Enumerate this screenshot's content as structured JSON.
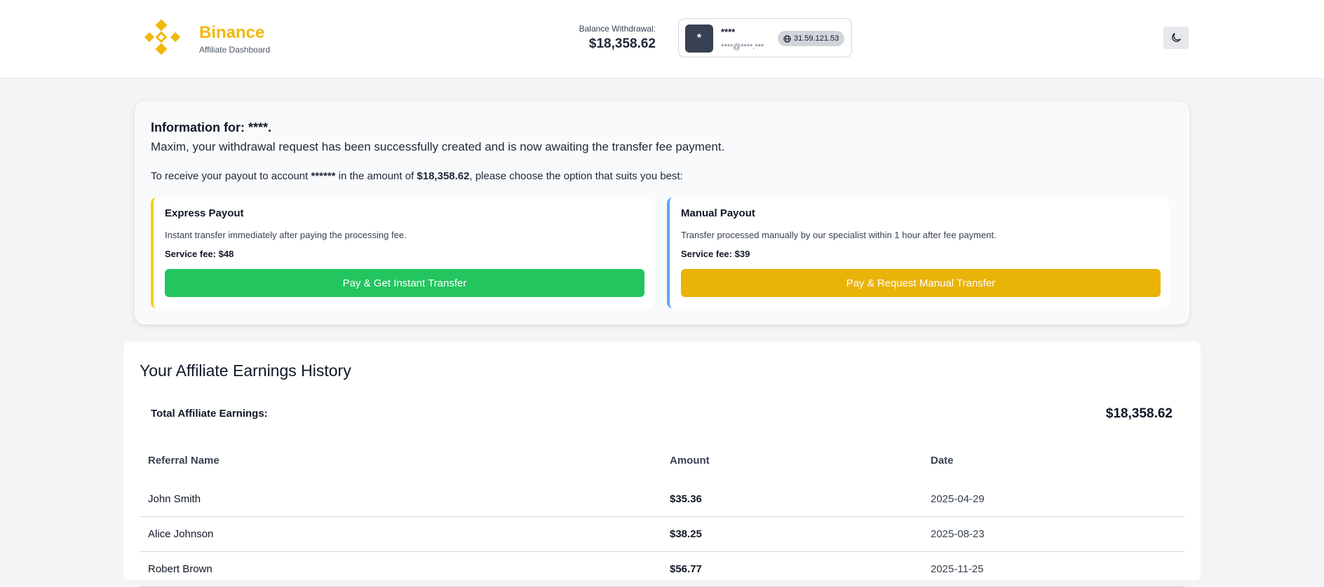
{
  "header": {
    "brand_name": "Binance",
    "brand_sub": "Affiliate Dashboard",
    "balance_label": "Balance Withdrawal:",
    "balance_value": "$18,358.62",
    "user": {
      "avatar_initial": "*",
      "name": "****",
      "email": "****@****.***",
      "ip": "31.59.121.53"
    },
    "brand_color": "#f0b90b"
  },
  "info": {
    "title": "Information for: ****.",
    "message": "Maxim, your withdrawal request has been successfully created and is now awaiting the transfer fee payment.",
    "line_prefix": "To receive your payout to account ",
    "account": "******",
    "line_middle": " in the amount of ",
    "amount": "$18,358.62",
    "line_suffix": ", please choose the option that suits you best:"
  },
  "options": {
    "express": {
      "title": "Express Payout",
      "desc": "Instant transfer immediately after paying the processing fee.",
      "fee": "Service fee: $48",
      "button": "Pay & Get Instant Transfer",
      "accent": "#facc15",
      "button_color": "#22c55e"
    },
    "manual": {
      "title": "Manual Payout",
      "desc": "Transfer processed manually by our specialist within 1 hour after fee payment.",
      "fee": "Service fee: $39",
      "button": "Pay & Request Manual Transfer",
      "accent": "#60a5fa",
      "button_color": "#eab308"
    }
  },
  "earnings": {
    "title": "Your Affiliate Earnings History",
    "total_label": "Total Affiliate Earnings:",
    "total_value": "$18,358.62",
    "columns": [
      "Referral Name",
      "Amount",
      "Date"
    ],
    "rows": [
      {
        "name": "John Smith",
        "amount": "$35.36",
        "date": "2025-04-29"
      },
      {
        "name": "Alice Johnson",
        "amount": "$38.25",
        "date": "2025-08-23"
      },
      {
        "name": "Robert Brown",
        "amount": "$56.77",
        "date": "2025-11-25"
      }
    ]
  }
}
